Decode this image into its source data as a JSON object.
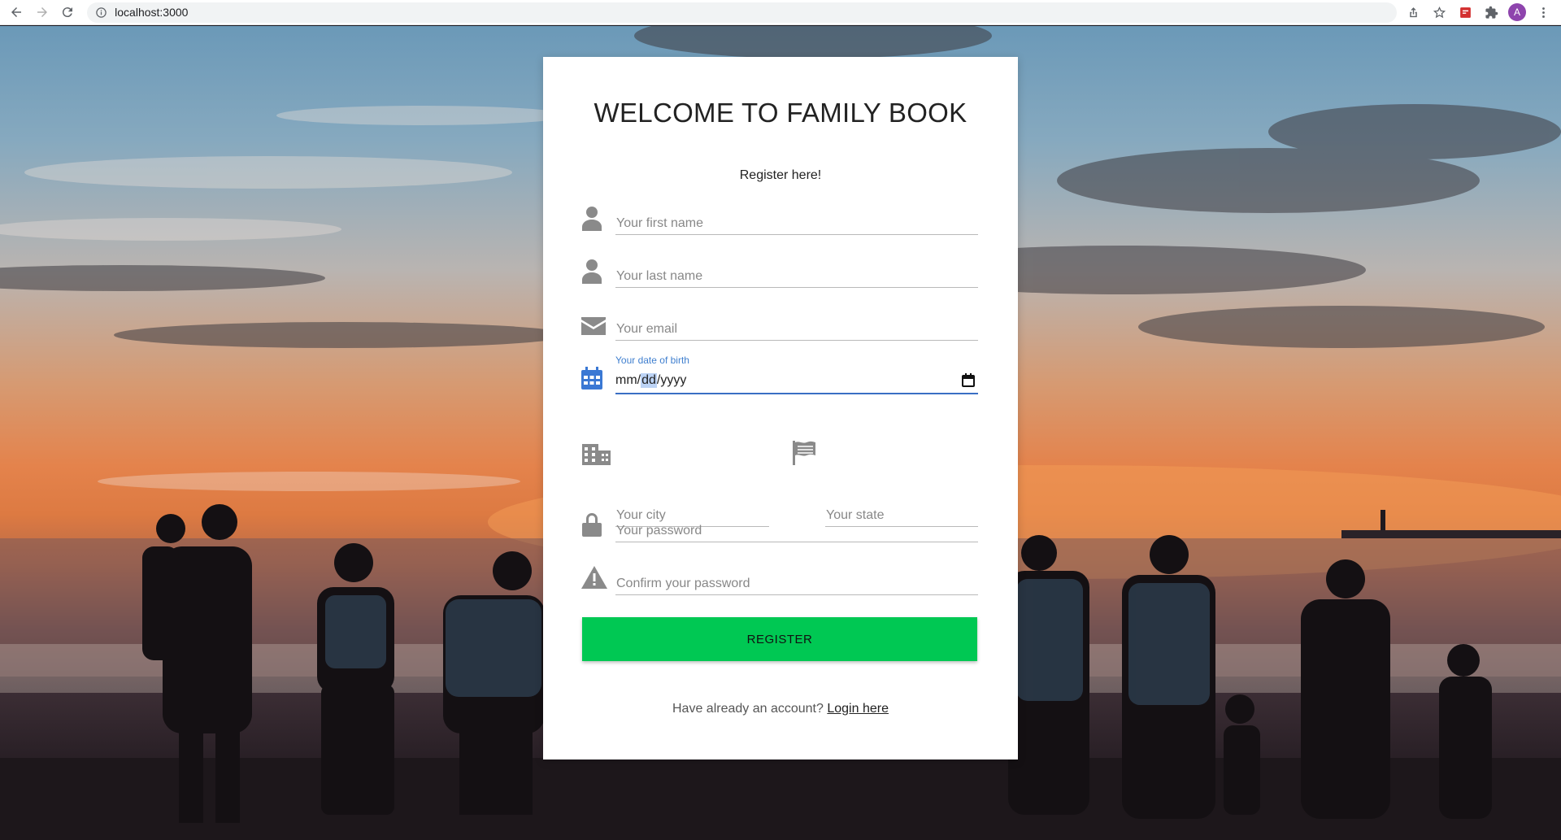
{
  "browser": {
    "url": "localhost:3000",
    "profile_initial": "A"
  },
  "page": {
    "title": "WELCOME TO FAMILY BOOK",
    "subtitle": "Register here!"
  },
  "form": {
    "first_name_placeholder": "Your first name",
    "last_name_placeholder": "Your last name",
    "email_placeholder": "Your email",
    "dob_label": "Your date of birth",
    "dob_mm": "mm",
    "dob_sep": "/",
    "dob_dd": "dd",
    "dob_yyyy": "yyyy",
    "city_placeholder": "Your city",
    "state_placeholder": "Your state",
    "password_placeholder": "Your password",
    "confirm_password_placeholder": "Confirm your password",
    "register_label": "REGISTER"
  },
  "footer": {
    "prompt": "Have already an account?",
    "login_link": "Login here"
  },
  "colors": {
    "register_button": "#00c853",
    "focus_accent": "#3a6fc4",
    "icon_gray": "#8a8a8a"
  },
  "icons": [
    "back-arrow-icon",
    "forward-arrow-icon",
    "reload-icon",
    "info-icon",
    "share-icon",
    "star-icon",
    "extension-badge-icon",
    "puzzle-icon",
    "kebab-menu-icon",
    "person-icon",
    "envelope-icon",
    "calendar-icon",
    "building-icon",
    "flag-icon",
    "lock-icon",
    "warning-icon"
  ]
}
